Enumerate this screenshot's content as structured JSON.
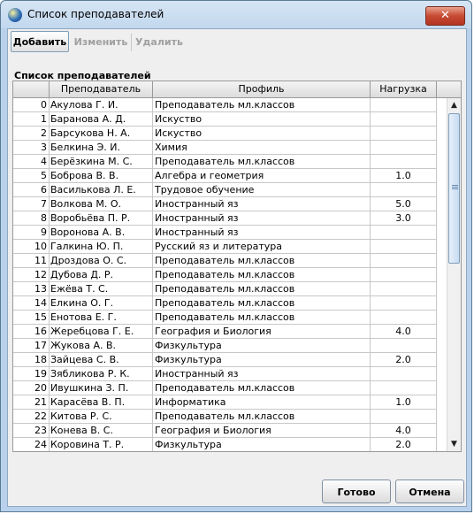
{
  "window": {
    "title": "Список преподавателей",
    "close_glyph": "✕"
  },
  "toolbar": {
    "add_label": "Добавить",
    "edit_label": "Изменить",
    "delete_label": "Удалить"
  },
  "group": {
    "title": "Список преподавателей"
  },
  "table": {
    "columns": [
      "",
      "Преподаватель",
      "Профиль",
      "Нагрузка"
    ],
    "rows": [
      {
        "num": "0",
        "name": "Акулова Г. И.",
        "profile": "Преподаватель мл.классов",
        "load": ""
      },
      {
        "num": "1",
        "name": "Баранова А. Д.",
        "profile": "Искуство",
        "load": ""
      },
      {
        "num": "2",
        "name": "Барсукова Н. А.",
        "profile": "Искуство",
        "load": ""
      },
      {
        "num": "3",
        "name": "Белкина Э. И.",
        "profile": "Химия",
        "load": ""
      },
      {
        "num": "4",
        "name": "Берёзкина М. С.",
        "profile": "Преподаватель мл.классов",
        "load": ""
      },
      {
        "num": "5",
        "name": "Боброва В. В.",
        "profile": "Алгебра и геометрия",
        "load": "1.0"
      },
      {
        "num": "6",
        "name": "Василькова Л. Е.",
        "profile": "Трудовое обучение",
        "load": ""
      },
      {
        "num": "7",
        "name": "Волкова М. О.",
        "profile": "Иностранный яз",
        "load": "5.0"
      },
      {
        "num": "8",
        "name": "Воробьёва П. Р.",
        "profile": "Иностранный яз",
        "load": "3.0"
      },
      {
        "num": "9",
        "name": "Воронова А. В.",
        "profile": "Иностранный яз",
        "load": ""
      },
      {
        "num": "10",
        "name": "Галкина Ю. П.",
        "profile": "Русский яз и литература",
        "load": ""
      },
      {
        "num": "11",
        "name": "Дроздова О. С.",
        "profile": "Преподаватель мл.классов",
        "load": ""
      },
      {
        "num": "12",
        "name": "Дубова Д. Р.",
        "profile": "Преподаватель мл.классов",
        "load": ""
      },
      {
        "num": "13",
        "name": "Ежёва Т. С.",
        "profile": "Преподаватель мл.классов",
        "load": ""
      },
      {
        "num": "14",
        "name": "Елкина О. Г.",
        "profile": "Преподаватель мл.классов",
        "load": ""
      },
      {
        "num": "15",
        "name": "Енотова Е. Г.",
        "profile": "Преподаватель мл.классов",
        "load": ""
      },
      {
        "num": "16",
        "name": "Жеребцова Г. Е.",
        "profile": "География и Биология",
        "load": "4.0"
      },
      {
        "num": "17",
        "name": "Жукова А. В.",
        "profile": "Физкультура",
        "load": ""
      },
      {
        "num": "18",
        "name": "Зайцева С. В.",
        "profile": "Физкультура",
        "load": "2.0"
      },
      {
        "num": "19",
        "name": "Зябликова Р. К.",
        "profile": "Иностранный яз",
        "load": ""
      },
      {
        "num": "20",
        "name": "Ивушкина З. П.",
        "profile": "Преподаватель мл.классов",
        "load": ""
      },
      {
        "num": "21",
        "name": "Карасёва В. П.",
        "profile": "Информатика",
        "load": "1.0"
      },
      {
        "num": "22",
        "name": "Китова Р. С.",
        "profile": "Преподаватель мл.классов",
        "load": ""
      },
      {
        "num": "23",
        "name": "Конева В. С.",
        "profile": "География и Биология",
        "load": "4.0"
      },
      {
        "num": "24",
        "name": "Коровина Т. Р.",
        "profile": "Физкультура",
        "load": "2.0"
      }
    ]
  },
  "buttons": {
    "ok_label": "Готово",
    "cancel_label": "Отмена"
  },
  "icons": {
    "scroll_up": "▲",
    "scroll_down": "▼"
  }
}
